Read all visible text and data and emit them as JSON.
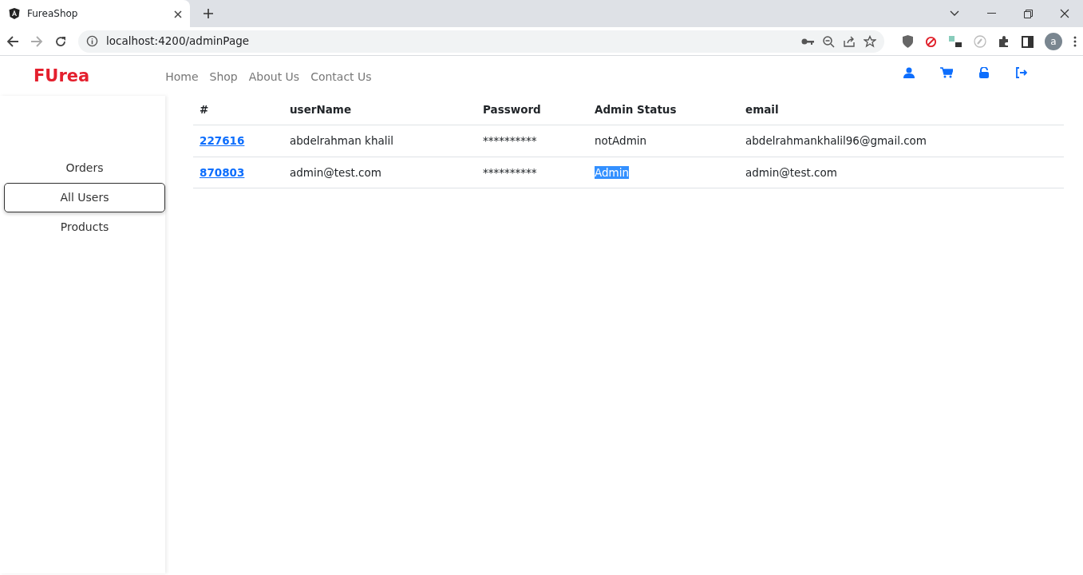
{
  "browser": {
    "tab_title": "FureaShop",
    "url": "localhost:4200/adminPage",
    "profile_initial": "a"
  },
  "navbar": {
    "brand": "FUrea",
    "links": [
      "Home",
      "Shop",
      "About Us",
      "Contact Us"
    ]
  },
  "sidebar": {
    "items": [
      {
        "label": "Orders",
        "selected": false
      },
      {
        "label": "All Users",
        "selected": true
      },
      {
        "label": "Products",
        "selected": false
      }
    ]
  },
  "table": {
    "columns": [
      "#",
      "userName",
      "Password",
      "Admin Status",
      "email"
    ],
    "rows": [
      {
        "id": "227616",
        "username": "abdelrahman khalil",
        "password": "**********",
        "admin_status": "notAdmin",
        "status_highlighted": false,
        "email": "abdelrahmankhalil96@gmail.com"
      },
      {
        "id": "870803",
        "username": "admin@test.com",
        "password": "**********",
        "admin_status": "Admin",
        "status_highlighted": true,
        "email": "admin@test.com"
      }
    ]
  }
}
